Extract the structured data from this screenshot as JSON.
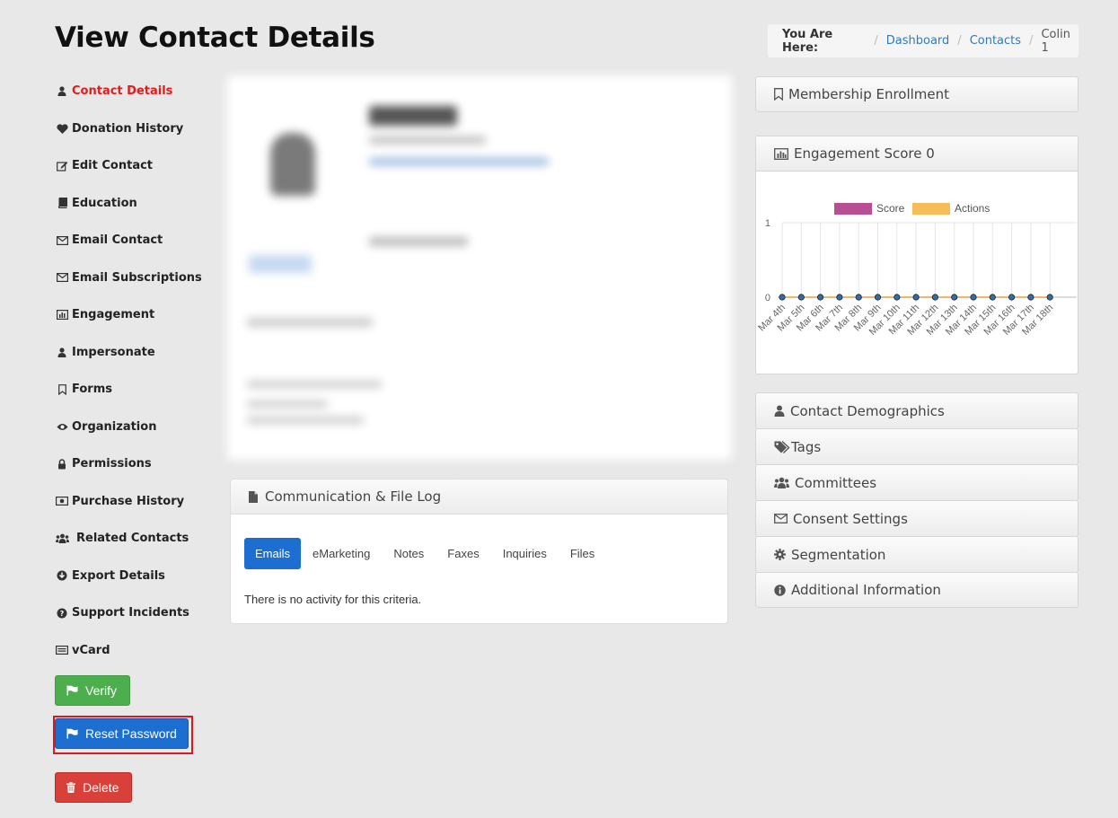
{
  "page_title": "View Contact Details",
  "breadcrumb": {
    "label": "You Are Here:",
    "items": [
      "Dashboard",
      "Contacts",
      "Colin 1"
    ]
  },
  "sidebar": {
    "items": [
      {
        "label": "Contact Details",
        "icon": "user-icon"
      },
      {
        "label": "Donation History",
        "icon": "heart-icon"
      },
      {
        "label": "Edit Contact",
        "icon": "edit-icon"
      },
      {
        "label": "Education",
        "icon": "book-icon"
      },
      {
        "label": "Email Contact",
        "icon": "envelope-icon"
      },
      {
        "label": "Email Subscriptions",
        "icon": "envelope-icon"
      },
      {
        "label": "Engagement",
        "icon": "bar-chart-icon"
      },
      {
        "label": "Impersonate",
        "icon": "user-icon"
      },
      {
        "label": "Forms",
        "icon": "bookmark-icon"
      },
      {
        "label": "Organization",
        "icon": "eye-icon"
      },
      {
        "label": "Permissions",
        "icon": "lock-icon"
      },
      {
        "label": "Purchase History",
        "icon": "money-icon"
      },
      {
        "label": "Related Contacts",
        "icon": "users-icon"
      },
      {
        "label": "Export Details",
        "icon": "download-icon"
      },
      {
        "label": "Support Incidents",
        "icon": "question-icon"
      },
      {
        "label": "vCard",
        "icon": "vcard-icon"
      }
    ]
  },
  "buttons": {
    "verify": "Verify",
    "reset_password": "Reset Password",
    "delete": "Delete"
  },
  "colors": {
    "active_nav": "#e41b1b",
    "primary": "#1c6fd1",
    "success": "#4cae4c",
    "danger": "#d9403a",
    "score_series": "#b94f93",
    "actions_series": "#f5bd56"
  },
  "comm_log": {
    "title": "Communication & File Log",
    "tabs": [
      "Emails",
      "eMarketing",
      "Notes",
      "Faxes",
      "Inquiries",
      "Files"
    ],
    "active_tab": "Emails",
    "empty_text": "There is no activity for this criteria."
  },
  "right_panels": {
    "membership": "Membership Enrollment",
    "engagement_title": "Engagement Score 0",
    "demographics": "Contact Demographics",
    "tags": "Tags",
    "committees": "Committees",
    "consent": "Consent Settings",
    "segmentation": "Segmentation",
    "additional": "Additional Information"
  },
  "chart_data": {
    "type": "line",
    "categories": [
      "Mar 4th",
      "Mar 5th",
      "Mar 6th",
      "Mar 7th",
      "Mar 8th",
      "Mar 9th",
      "Mar 10th",
      "Mar 11th",
      "Mar 12th",
      "Mar 13th",
      "Mar 14th",
      "Mar 15th",
      "Mar 16th",
      "Mar 17th",
      "Mar 18th"
    ],
    "series": [
      {
        "name": "Score",
        "values": [
          0,
          0,
          0,
          0,
          0,
          0,
          0,
          0,
          0,
          0,
          0,
          0,
          0,
          0,
          0
        ]
      },
      {
        "name": "Actions",
        "values": [
          0,
          0,
          0,
          0,
          0,
          0,
          0,
          0,
          0,
          0,
          0,
          0,
          0,
          0,
          0
        ]
      }
    ],
    "ylim": [
      0,
      1
    ],
    "yticks": [
      "1",
      "0"
    ],
    "legend": "top"
  }
}
